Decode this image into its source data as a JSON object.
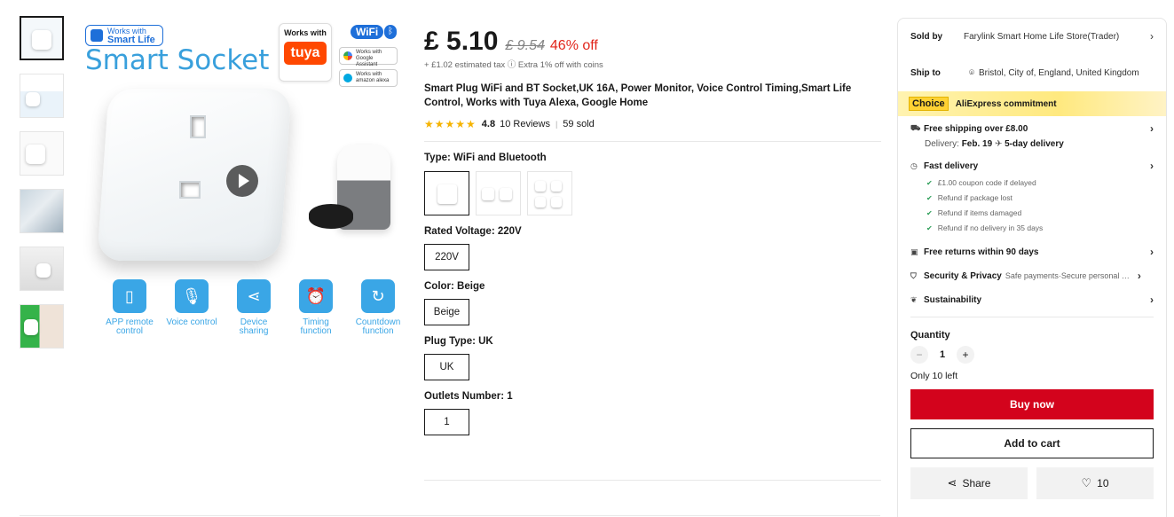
{
  "gallery": {
    "thumbnails": [
      "thumb-1",
      "thumb-2",
      "thumb-3",
      "thumb-4",
      "thumb-5",
      "thumb-6"
    ],
    "main": {
      "badge_top": "Works with",
      "badge_brand": "Smart Life",
      "headline": "Smart Socket",
      "tuya_top": "Works with",
      "tuya_logo": "tuya",
      "wifi": "WiFi",
      "google_top": "Works with",
      "google": "Google Assistant",
      "alexa_top": "Works with",
      "alexa": "amazon alexa",
      "features": [
        "APP remote control",
        "Voice control",
        "Device sharing",
        "Timing function",
        "Countdown function"
      ]
    }
  },
  "product": {
    "price": "£ 5.10",
    "original_price": "£ 9.54",
    "discount": "46% off",
    "tax_line": "+ £1.02 estimated tax ⓘ Extra 1% off with coins",
    "title": "Smart Plug WiFi and BT Socket,UK 16A, Power Monitor, Voice Control Timing,Smart Life Control, Works with Tuya Alexa, Google Home",
    "rating": "4.8",
    "reviews": "10 Reviews",
    "sold": "59 sold",
    "type_label": "Type: WiFi and Bluetooth",
    "voltage_label": "Rated Voltage: 220V",
    "voltage_option": "220V",
    "color_label": "Color: Beige",
    "color_option": "Beige",
    "plug_label": "Plug Type: UK",
    "plug_option": "UK",
    "outlets_label": "Outlets Number: 1",
    "outlets_option": "1"
  },
  "panel": {
    "sold_by_label": "Sold by",
    "sold_by_value": "Farylink Smart Home Life Store(Trader)",
    "ship_to_label": "Ship to",
    "ship_to_value": "Bristol, City of, England, United Kingdom",
    "choice_tag": "Choice",
    "choice_text": "AliExpress commitment",
    "free_shipping": "Free shipping over £8.00",
    "delivery_prefix": "Delivery:",
    "delivery_date": "Feb. 19",
    "delivery_speed": "5-day delivery",
    "fast_delivery": "Fast delivery",
    "benefits": [
      "£1.00 coupon code if delayed",
      "Refund if package lost",
      "Refund if items damaged",
      "Refund if no delivery in 35 days"
    ],
    "free_returns": "Free returns within 90 days",
    "security": "Security & Privacy",
    "security_sub": "Safe payments·Secure personal details",
    "sustainability": "Sustainability",
    "quantity_label": "Quantity",
    "quantity_value": "1",
    "only_left": "Only 10 left",
    "buy_now": "Buy now",
    "add_to_cart": "Add to cart",
    "share": "Share",
    "wishlist_count": "10"
  }
}
